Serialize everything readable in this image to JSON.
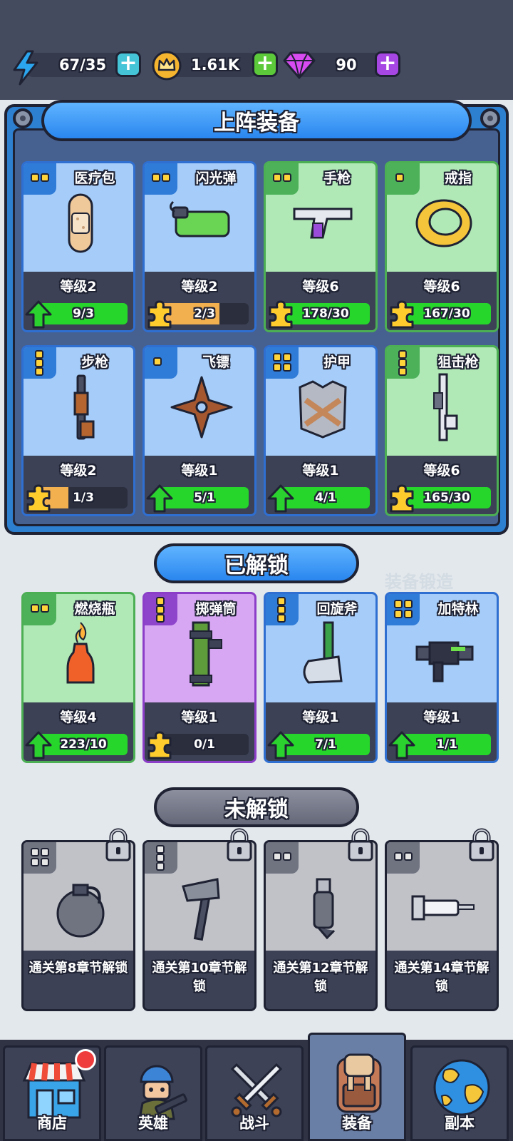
{
  "resources": {
    "energy": "67/35",
    "coins": "1.61K",
    "gems": "90"
  },
  "equipped": {
    "title": "上阵装备",
    "cards": [
      {
        "name": "医疗包",
        "level": "等级2",
        "progress": "9/3",
        "fill": 1.0,
        "rarity": "rare",
        "pips": 2,
        "action": "upgrade"
      },
      {
        "name": "闪光弹",
        "level": "等级2",
        "progress": "2/3",
        "fill": 0.67,
        "rarity": "rare",
        "pips": 2,
        "action": "fragment"
      },
      {
        "name": "手枪",
        "level": "等级6",
        "progress": "178/30",
        "fill": 1.0,
        "rarity": "common",
        "pips": 2,
        "action": "fragment"
      },
      {
        "name": "戒指",
        "level": "等级6",
        "progress": "167/30",
        "fill": 1.0,
        "rarity": "common",
        "pips": 1,
        "action": "fragment"
      },
      {
        "name": "步枪",
        "level": "等级2",
        "progress": "1/3",
        "fill": 0.33,
        "rarity": "rare",
        "pips": 3,
        "action": "fragment"
      },
      {
        "name": "飞镖",
        "level": "等级1",
        "progress": "5/1",
        "fill": 1.0,
        "rarity": "rare",
        "pips": 1,
        "action": "upgrade"
      },
      {
        "name": "护甲",
        "level": "等级1",
        "progress": "4/1",
        "fill": 1.0,
        "rarity": "rare",
        "pips": 4,
        "action": "upgrade"
      },
      {
        "name": "狙击枪",
        "level": "等级6",
        "progress": "165/30",
        "fill": 1.0,
        "rarity": "common",
        "pips": 3,
        "action": "fragment"
      }
    ]
  },
  "unlocked": {
    "title": "已解锁",
    "cards": [
      {
        "name": "燃烧瓶",
        "level": "等级4",
        "progress": "223/10",
        "fill": 1.0,
        "rarity": "common",
        "pips": 2,
        "action": "upgrade"
      },
      {
        "name": "掷弹筒",
        "level": "等级1",
        "progress": "0/1",
        "fill": 0.0,
        "rarity": "epic",
        "pips": 3,
        "action": "fragment"
      },
      {
        "name": "回旋斧",
        "level": "等级1",
        "progress": "7/1",
        "fill": 1.0,
        "rarity": "rare",
        "pips": 3,
        "action": "upgrade"
      },
      {
        "name": "加特林",
        "level": "等级1",
        "progress": "1/1",
        "fill": 1.0,
        "rarity": "rare",
        "pips": 4,
        "action": "upgrade"
      }
    ]
  },
  "locked": {
    "title": "未解锁",
    "cards": [
      {
        "text": "通关第8章节解锁"
      },
      {
        "text": "通关第10章节解锁"
      },
      {
        "text": "通关第12章节解锁"
      },
      {
        "text": "通关第14章节解锁"
      }
    ]
  },
  "background_text": "装备锻造",
  "nav": {
    "shop": "商店",
    "heroes": "英雄",
    "battle": "战斗",
    "equipment": "装备",
    "dungeon": "副本"
  },
  "colors": {
    "rare": "#a6cdf9",
    "common": "#b1e9b6",
    "epic": "#d7a7f3",
    "progress_full": "#27d62b",
    "progress_partial": "#f3b04f"
  }
}
